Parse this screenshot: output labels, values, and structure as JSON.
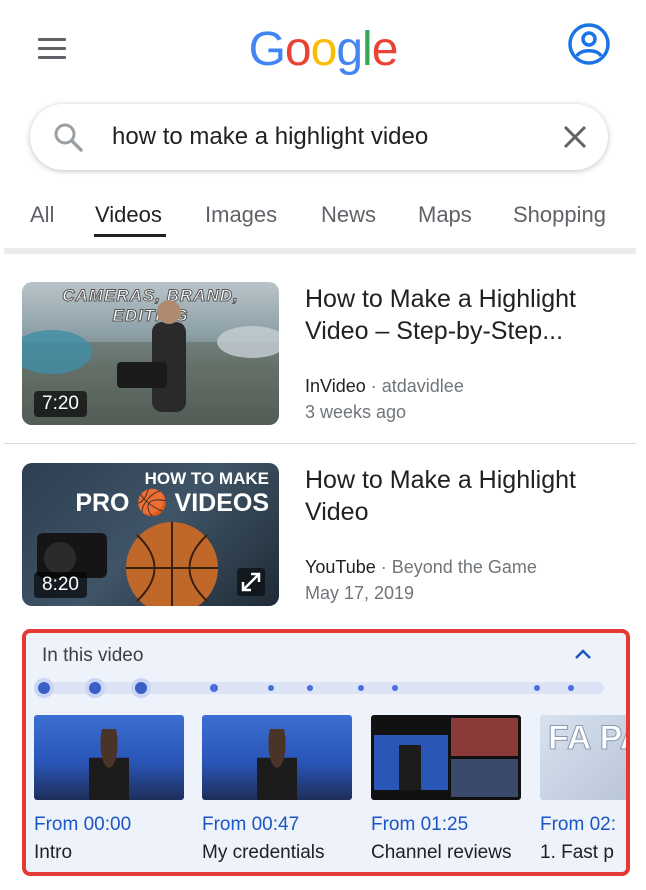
{
  "header": {
    "logo_letters": [
      {
        "char": "G",
        "color": "#4285F4"
      },
      {
        "char": "o",
        "color": "#EA4335"
      },
      {
        "char": "o",
        "color": "#FBBC05"
      },
      {
        "char": "g",
        "color": "#4285F4"
      },
      {
        "char": "l",
        "color": "#34A853"
      },
      {
        "char": "e",
        "color": "#EA4335"
      }
    ],
    "menu_icon": "hamburger-menu-icon",
    "account_icon": "account-circle-icon"
  },
  "search": {
    "query": "how to make a highlight video",
    "search_icon": "search-icon",
    "clear_icon": "close-icon"
  },
  "tabs": [
    {
      "label": "All",
      "active": false
    },
    {
      "label": "Videos",
      "active": true
    },
    {
      "label": "Images",
      "active": false
    },
    {
      "label": "News",
      "active": false
    },
    {
      "label": "Maps",
      "active": false
    },
    {
      "label": "Shopping",
      "active": false
    }
  ],
  "results": [
    {
      "title_line1": "How to Make a Highlight",
      "title_line2": "Video – Step-by-Step...",
      "source": "InVideo",
      "separator": "·",
      "author": "atdavidlee",
      "date": "3 weeks ago",
      "duration": "7:20",
      "thumb_banner": "CAMERAS, BRAND, EDITING"
    },
    {
      "title_line1": "How to Make a Highlight",
      "title_line2": "Video",
      "source": "YouTube",
      "separator": "·",
      "author": "Beyond the Game",
      "date": "May 17, 2019",
      "duration": "8:20",
      "thumb_text1": "HOW TO MAKE",
      "thumb_text2": "PRO 🏀 VIDEOS"
    }
  ],
  "in_this_video": {
    "title": "In this video",
    "chapters": [
      {
        "time": "From 00:00",
        "label": "Intro"
      },
      {
        "time": "From 00:47",
        "label": "My credentials"
      },
      {
        "time": "From 01:25",
        "label": "Channel reviews"
      },
      {
        "time": "From 02:",
        "label": "1. Fast p",
        "thumb_text": "FA PA"
      }
    ]
  },
  "colors": {
    "accent_blue": "#1a56c4",
    "highlight_border": "#e53935",
    "panel_bg": "#eef2fb"
  }
}
